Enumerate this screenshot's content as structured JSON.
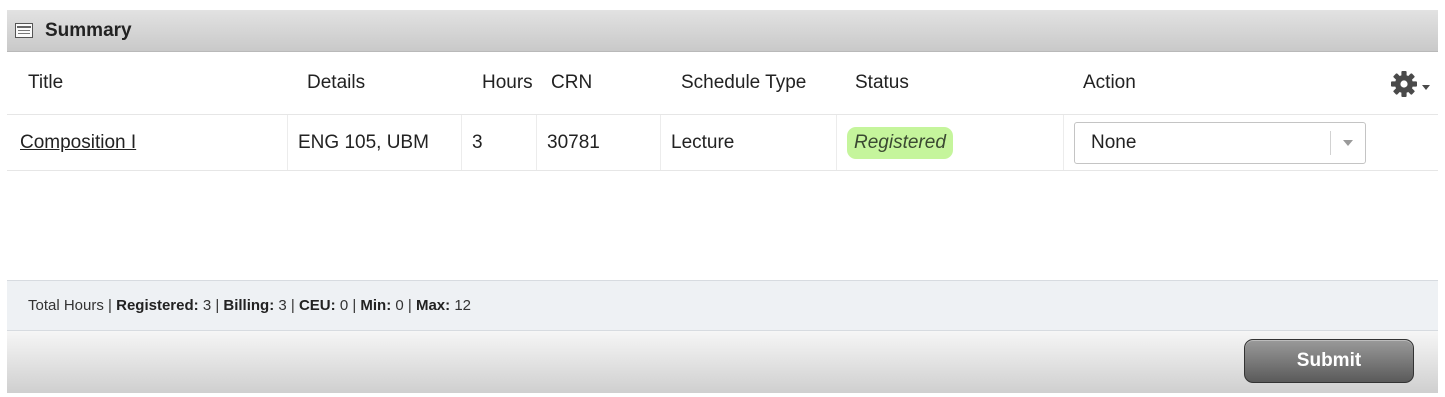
{
  "header": {
    "title": "Summary",
    "icon": "table-icon"
  },
  "columns": [
    "Title",
    "Details",
    "Hours",
    "CRN",
    "Schedule Type",
    "Status",
    "Action"
  ],
  "rows": [
    {
      "title": "Composition I",
      "details": "ENG 105, UBM",
      "hours": "3",
      "crn": "30781",
      "schedule_type": "Lecture",
      "status": "Registered",
      "status_color": "#c5f59c",
      "action": "None"
    }
  ],
  "totals": {
    "label": "Total Hours",
    "registered_label": "Registered:",
    "registered": "3",
    "billing_label": "Billing:",
    "billing": "3",
    "ceu_label": "CEU:",
    "ceu": "0",
    "min_label": "Min:",
    "min": "0",
    "max_label": "Max:",
    "max": "12"
  },
  "footer": {
    "submit_label": "Submit"
  },
  "settings_icon": "gear-icon"
}
